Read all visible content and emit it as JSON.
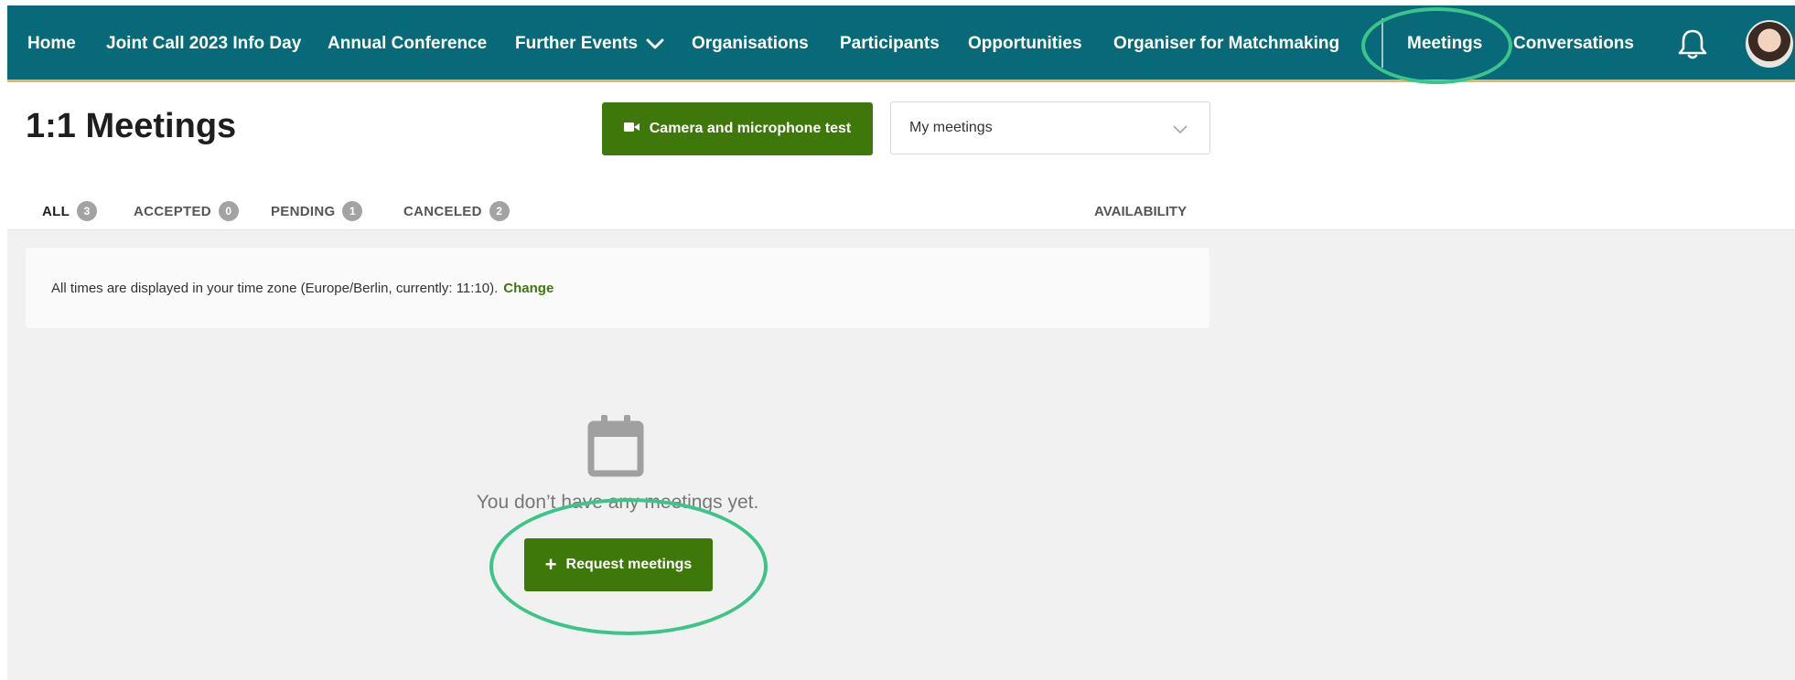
{
  "nav": {
    "items": [
      {
        "label": "Home"
      },
      {
        "label": "Joint Call 2023 Info Day"
      },
      {
        "label": "Annual Conference"
      },
      {
        "label": "Further Events"
      },
      {
        "label": "Organisations"
      },
      {
        "label": "Participants"
      },
      {
        "label": "Opportunities"
      },
      {
        "label": "Organiser for Matchmaking"
      },
      {
        "label": "Meetings"
      },
      {
        "label": "Conversations"
      }
    ],
    "notifications_icon": "bell-icon",
    "avatar_icon": "user-avatar"
  },
  "page": {
    "title": "1:1 Meetings",
    "camera_button": "Camera and microphone test",
    "camera_icon": "video-camera-icon",
    "filter": {
      "selected": "My meetings"
    }
  },
  "tabs": [
    {
      "label": "ALL",
      "count": "3"
    },
    {
      "label": "ACCEPTED",
      "count": "0"
    },
    {
      "label": "PENDING",
      "count": "1"
    },
    {
      "label": "CANCELED",
      "count": "2"
    }
  ],
  "availability_tab": "AVAILABILITY",
  "timezone": {
    "text": "All times are displayed in your time zone (Europe/Berlin, currently: 11:10).",
    "change_label": "Change"
  },
  "empty_state": {
    "icon": "calendar-icon",
    "message": "You don’t have any meetings yet.",
    "button": "Request meetings"
  },
  "colors": {
    "nav_bg": "#086a78",
    "nav_underline": "#f2b45a",
    "primary_green": "#3f780a",
    "annotation": "#3cc48b",
    "content_bg": "#f1f1f1"
  }
}
